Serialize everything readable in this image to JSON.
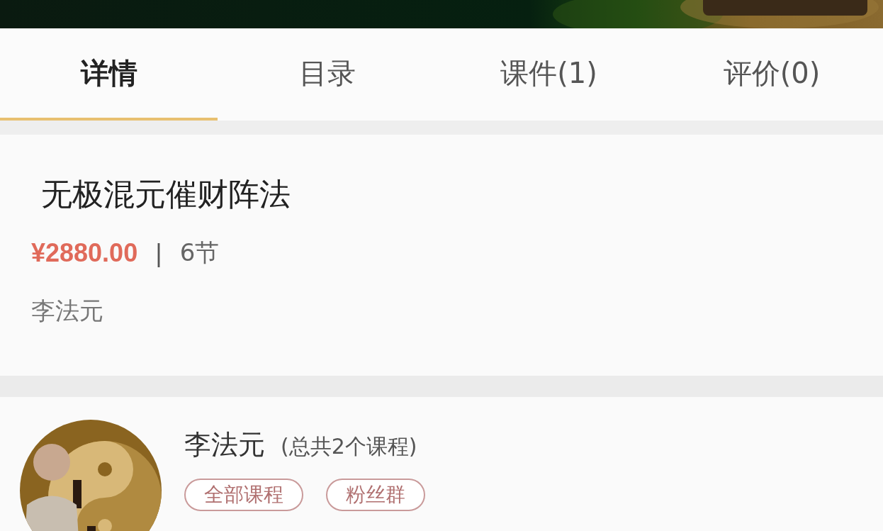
{
  "tabs": [
    {
      "label": "详情",
      "selected": true
    },
    {
      "label": "目录",
      "selected": false
    },
    {
      "label": "课件(1)",
      "selected": false
    },
    {
      "label": "评价(0)",
      "selected": false
    }
  ],
  "course": {
    "title": "无极混元催财阵法",
    "price": "¥2880.00",
    "separator": "|",
    "lessons": "6节",
    "author": "李法元"
  },
  "teacher": {
    "name": "李法元",
    "course_count": "(总共2个课程)",
    "buttons": [
      "全部课程",
      "粉丝群"
    ]
  }
}
